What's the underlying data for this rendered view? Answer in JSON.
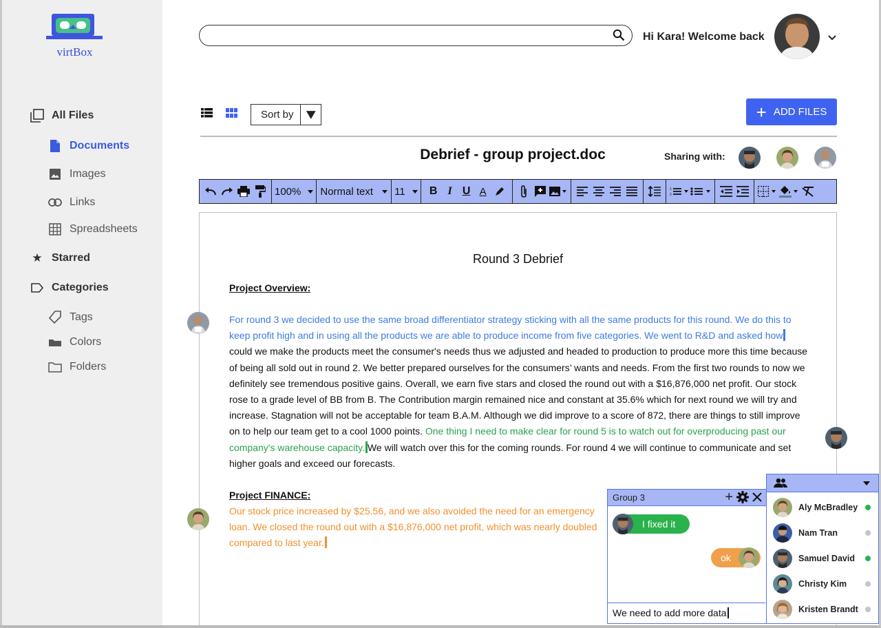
{
  "app": {
    "name": "virtBox"
  },
  "colors": {
    "accent": "#3f63f0",
    "toolbar": "#a7b6f4",
    "online": "#2ab24c",
    "offline": "#c4c4c4",
    "text_blue": "#3e7be0",
    "text_green": "#2aa24c",
    "text_orange": "#f0902e"
  },
  "sidebar": {
    "items": [
      {
        "label": "All Files",
        "icon": "copy-icon"
      },
      {
        "label": "Documents",
        "icon": "document-icon",
        "active": true
      },
      {
        "label": "Images",
        "icon": "image-icon"
      },
      {
        "label": "Links",
        "icon": "link-icon"
      },
      {
        "label": "Spreadsheets",
        "icon": "grid-icon"
      },
      {
        "label": "Starred",
        "icon": "star-icon"
      },
      {
        "label": "Categories",
        "icon": "label-icon"
      },
      {
        "label": "Tags",
        "icon": "tag-icon"
      },
      {
        "label": "Colors",
        "icon": "color-swatch-icon"
      },
      {
        "label": "Folders",
        "icon": "folder-icon"
      }
    ]
  },
  "header": {
    "search_value": "",
    "greeting": "Hi Kara! Welcome back"
  },
  "toolbar": {
    "sort_label": "Sort by",
    "add_files_label": "ADD FILES"
  },
  "document": {
    "title": "Debrief -  group project.doc",
    "sharing_label": "Sharing with:",
    "format": {
      "zoom": "100%",
      "style": "Normal text",
      "font_size": "11"
    },
    "heading": "Round 3 Debrief",
    "overview_heading": "Project Overview:",
    "overview_blue": "For round 3 we decided to use the same broad differentiator strategy sticking with all the same products for this round. We do this to keep profit high and in using all the products we are able to produce income from five categories. We went to R&D and asked how",
    "overview_black1": "could we make the products meet the consumer's needs thus we adjusted and headed to production to produce more this time because of being all sold out in round 2. We better prepared ourselves for the consumers’ wants and needs. From the first two rounds to now we definitely see tremendous positive gains. Overall, we earn five stars and closed the round out with a $16,876,000 net profit. Our stock rose to a grade level of BB from B. The Contribution margin remained nice and constant at 35.6% which for next round we will try and increase. Stagnation will not be acceptable for team B.A.M. Although we did improve to a score of 872, there are things to still improve on to help our team get to a cool 1000 points.",
    "overview_green": "One thing I need to make clear for round 5 is to watch out for overproducing past our company's warehouse capacity.",
    "overview_black2": "We will watch over this for the coming rounds. For round 4 we will continue to communicate and set higher goals and exceed our forecasts.",
    "finance_heading": "Project FINANCE: ",
    "finance_orange": "Our stock price increased by $25.56, and we also avoided the need for an emergency loan. We closed the round out with a $16,876,000 net profit, which was nearly doubled compared to last year."
  },
  "chat": {
    "title": "Group 3",
    "messages": [
      {
        "text": "I fixed it",
        "color": "#2ab24c"
      },
      {
        "text": "ok",
        "color": "#f0a04b"
      }
    ],
    "input_value": "We need to add more data"
  },
  "people": [
    {
      "name": "Aly McBradley",
      "online": true
    },
    {
      "name": "Nam Tran",
      "online": false
    },
    {
      "name": "Samuel David",
      "online": true
    },
    {
      "name": "Christy Kim",
      "online": false
    },
    {
      "name": "Kristen Brandt",
      "online": false
    }
  ]
}
